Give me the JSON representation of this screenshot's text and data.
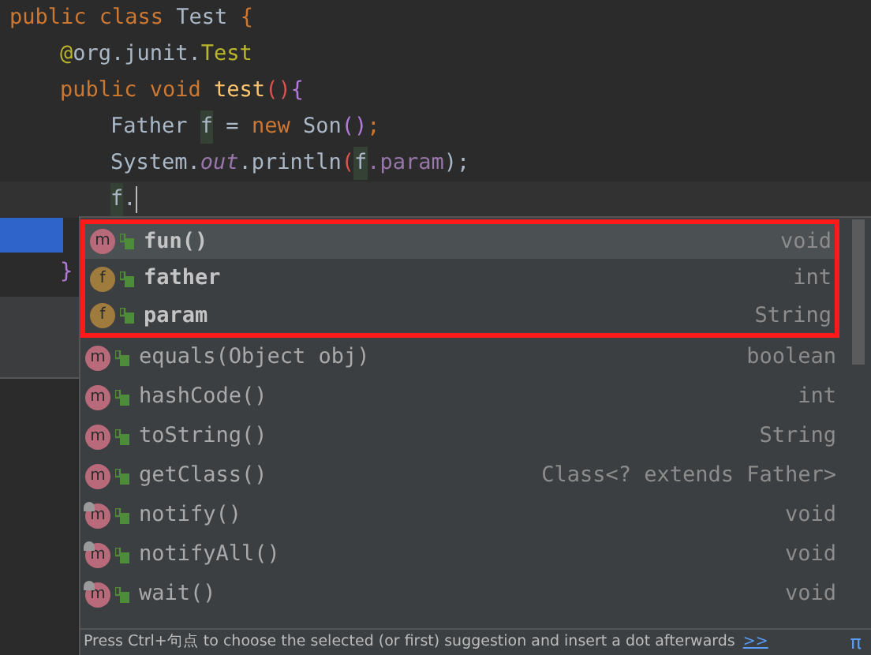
{
  "code_lines": [
    {
      "tokens": [
        {
          "text": "public class ",
          "kind": "keyword"
        },
        {
          "text": "Test ",
          "kind": "plain"
        },
        {
          "text": "{",
          "kind": "keyword"
        }
      ],
      "children": [
        {
          "tokens": [
            {
              "text": "@",
              "kind": "annotation"
            },
            {
              "text": "org.junit.",
              "kind": "plain"
            },
            {
              "text": "Test",
              "kind": "annotation"
            }
          ]
        },
        {
          "tokens": [
            {
              "text": "public void ",
              "kind": "keyword"
            },
            {
              "text": "test",
              "kind": "method"
            },
            {
              "text": "()",
              "kind": "paren"
            },
            {
              "text": "{",
              "kind": "brace"
            }
          ],
          "children": [
            {
              "tokens": [
                {
                  "text": "Father ",
                  "kind": "plain"
                },
                {
                  "text": "f",
                  "kind": "usage"
                },
                {
                  "text": " = ",
                  "kind": "plain"
                },
                {
                  "text": "new ",
                  "kind": "keyword"
                },
                {
                  "text": "Son",
                  "kind": "plain"
                },
                {
                  "text": "()",
                  "kind": "brace"
                },
                {
                  "text": ";",
                  "kind": "keyword"
                }
              ]
            },
            {
              "tokens": [
                {
                  "text": "System.",
                  "kind": "plain"
                },
                {
                  "text": "out",
                  "kind": "field"
                },
                {
                  "text": ".println",
                  "kind": "plain"
                },
                {
                  "text": "(",
                  "kind": "paren"
                },
                {
                  "text": "f",
                  "kind": "usage"
                },
                {
                  "text": ".param",
                  "kind": "field_plain"
                },
                {
                  "text": ");",
                  "kind": "plain"
                }
              ]
            },
            {
              "tokens": [
                {
                  "text": "f",
                  "kind": "usage"
                },
                {
                  "text": ".",
                  "kind": "plain"
                }
              ],
              "current": true
            }
          ]
        },
        {
          "tokens": [
            {
              "text": "}",
              "kind": "brace"
            }
          ]
        }
      ]
    }
  ],
  "completion": {
    "rows": [
      {
        "icon_letter": "m",
        "kind": "method",
        "name": "fun()",
        "type": "void",
        "bold": true,
        "final": false,
        "selected": true,
        "highlighted": true
      },
      {
        "icon_letter": "f",
        "kind": "field",
        "name": "father",
        "type": "int",
        "bold": true,
        "final": false,
        "selected": false,
        "highlighted": true
      },
      {
        "icon_letter": "f",
        "kind": "field",
        "name": "param",
        "type": "String",
        "bold": true,
        "final": false,
        "selected": false,
        "highlighted": true
      },
      {
        "icon_letter": "m",
        "kind": "method",
        "name": "equals(Object obj)",
        "type": "boolean",
        "bold": false,
        "final": false,
        "selected": false,
        "highlighted": false
      },
      {
        "icon_letter": "m",
        "kind": "method",
        "name": "hashCode()",
        "type": "int",
        "bold": false,
        "final": false,
        "selected": false,
        "highlighted": false
      },
      {
        "icon_letter": "m",
        "kind": "method",
        "name": "toString()",
        "type": "String",
        "bold": false,
        "final": false,
        "selected": false,
        "highlighted": false
      },
      {
        "icon_letter": "m",
        "kind": "method",
        "name": "getClass()",
        "type": "Class<? extends Father>",
        "bold": false,
        "final": false,
        "selected": false,
        "highlighted": false
      },
      {
        "icon_letter": "m",
        "kind": "method",
        "name": "notify()",
        "type": "void",
        "bold": false,
        "final": true,
        "selected": false,
        "highlighted": false
      },
      {
        "icon_letter": "m",
        "kind": "method",
        "name": "notifyAll()",
        "type": "void",
        "bold": false,
        "final": true,
        "selected": false,
        "highlighted": false
      },
      {
        "icon_letter": "m",
        "kind": "method",
        "name": "wait()",
        "type": "void",
        "bold": false,
        "final": true,
        "selected": false,
        "highlighted": false
      }
    ],
    "hint": "Press Ctrl+句点 to choose the selected (or first) suggestion and insert a dot afterwards",
    "hint_link": ">>",
    "corner_symbol": "π"
  }
}
